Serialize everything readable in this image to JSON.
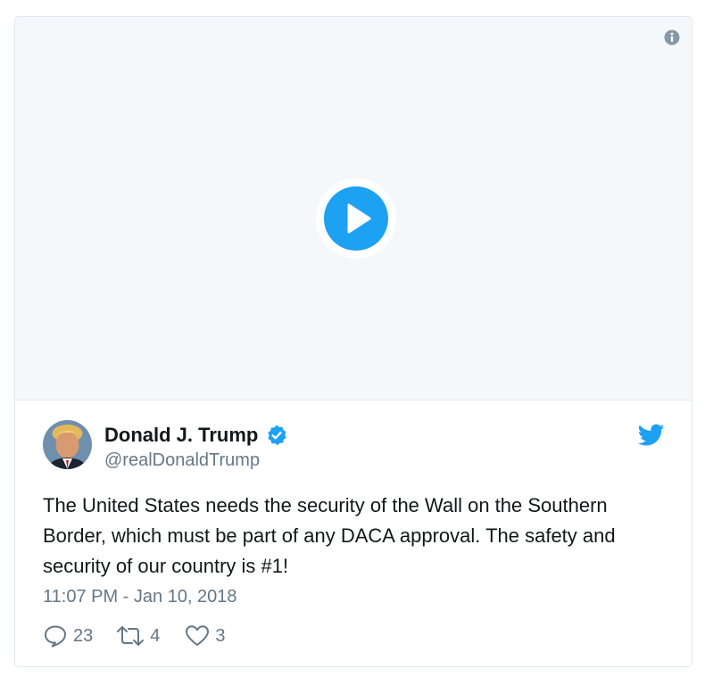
{
  "tweet": {
    "author": {
      "display_name": "Donald J. Trump",
      "handle": "@realDonaldTrump",
      "verified": true
    },
    "text": "The United States needs the security of the Wall on the Southern Border, which must be part of any DACA approval. The safety and security of our country is #1!",
    "timestamp": "11:07 PM - Jan 10, 2018",
    "stats": {
      "replies": "23",
      "retweets": "4",
      "likes": "3"
    }
  },
  "icons": {
    "info": "info-icon",
    "play": "play-icon",
    "verified": "verified-badge-icon",
    "brand": "twitter-bird-icon",
    "reply": "reply-icon",
    "retweet": "retweet-icon",
    "like": "heart-icon"
  },
  "colors": {
    "accent": "#1da1f2",
    "media_background": "#f5f8fa",
    "text_primary": "#14171a",
    "text_secondary": "#657786",
    "border": "#e1e8ed"
  }
}
